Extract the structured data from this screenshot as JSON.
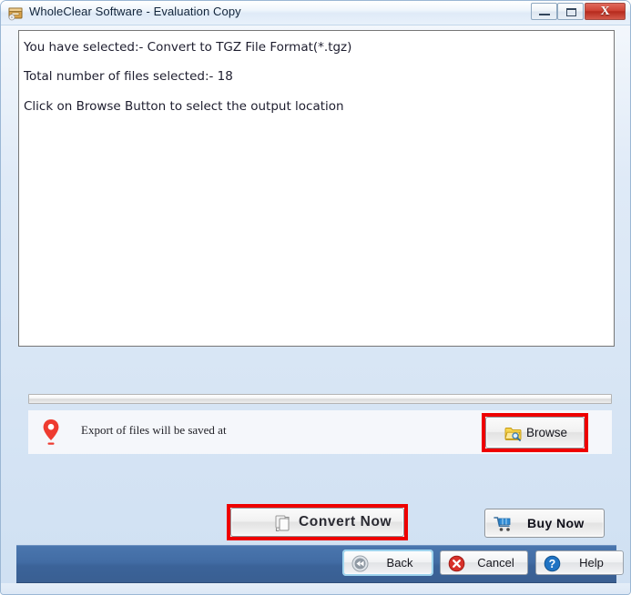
{
  "window": {
    "title": "WholeClear Software - Evaluation Copy",
    "app_icon": "archive-box-icon",
    "controls": {
      "minimize": "minimize-button",
      "maximize": "maximize-button",
      "close_glyph": "X"
    }
  },
  "content": {
    "messages": [
      "You have selected:- Convert to TGZ File Format(*.tgz)",
      "Total number of files selected:-  18",
      "Click on Browse Button to select the output location"
    ]
  },
  "export": {
    "label": "Export of files will be saved at",
    "pin_icon": "location-pin-icon",
    "browse": {
      "label": "Browse",
      "icon": "folder-search-icon",
      "highlighted": true
    }
  },
  "actions": {
    "convert": {
      "label": "Convert Now",
      "icon": "copy-files-icon",
      "highlighted": true
    },
    "buy": {
      "label": "Buy Now",
      "icon": "shopping-cart-icon"
    }
  },
  "bottom_bar": {
    "back": {
      "label": "Back",
      "icon": "rewind-icon"
    },
    "cancel": {
      "label": "Cancel",
      "icon": "error-circle-icon"
    },
    "help": {
      "label": "Help",
      "icon": "question-circle-icon"
    }
  },
  "colors": {
    "highlight_red": "#ee0000",
    "bottom_bar_blue": "#426ca4",
    "close_red": "#cf4436",
    "pin_red": "#e8443a",
    "cart_blue": "#2a7fc9"
  }
}
